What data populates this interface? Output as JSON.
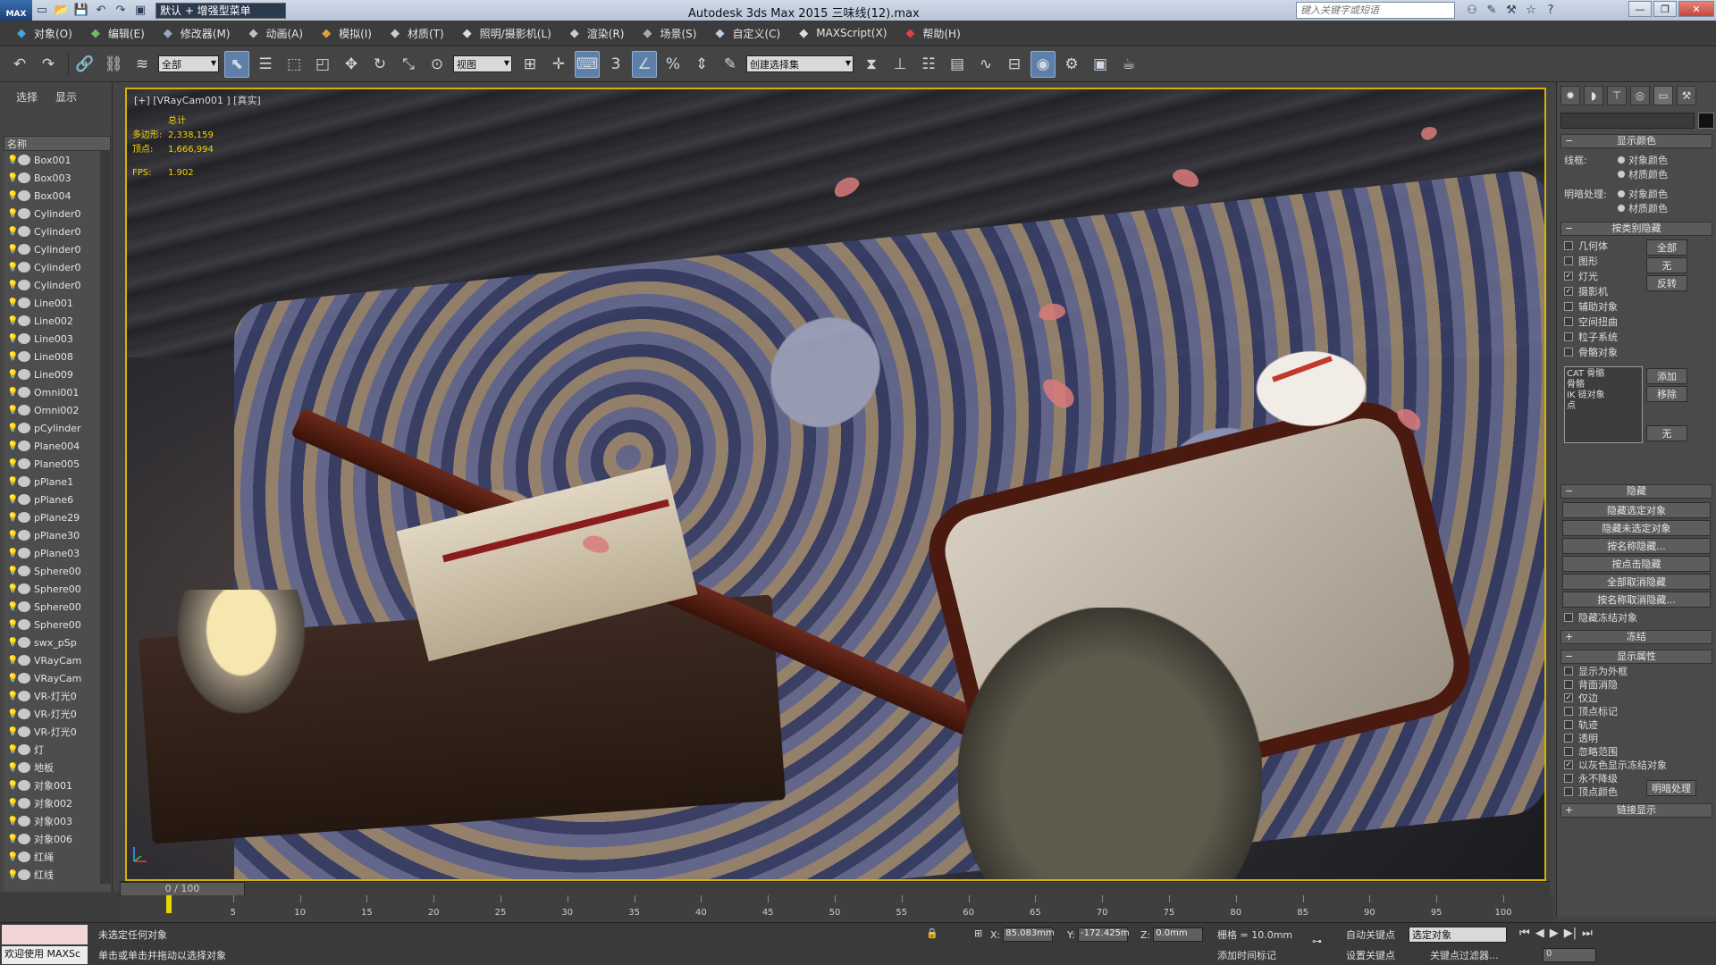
{
  "titlebar": {
    "app_logo": "MAX",
    "workspace": "默认 + 增强型菜单",
    "window_title": "Autodesk 3ds Max  2015      三味线(12).max",
    "search_placeholder": "键入关键字或短语",
    "right_icons": [
      "binoculars-icon",
      "tools-icon",
      "exchange-icon",
      "star-icon",
      "help-icon"
    ],
    "controls": [
      "—",
      "❐",
      "✕"
    ]
  },
  "menus": [
    {
      "label": "对象(O)",
      "icon": "objects-icon",
      "color": "#4aa0e0"
    },
    {
      "label": "编辑(E)",
      "icon": "edit-icon",
      "color": "#6bbf5a"
    },
    {
      "label": "修改器(M)",
      "icon": "modifier-icon",
      "color": "#9aa8c0"
    },
    {
      "label": "动画(A)",
      "icon": "animation-icon",
      "color": "#c0c0c0"
    },
    {
      "label": "模拟(I)",
      "icon": "simulation-icon",
      "color": "#e0a040"
    },
    {
      "label": "材质(T)",
      "icon": "material-icon",
      "color": "#cccccc"
    },
    {
      "label": "照明/摄影机(L)",
      "icon": "light-icon",
      "color": "#dddddd"
    },
    {
      "label": "渲染(R)",
      "icon": "render-icon",
      "color": "#cccccc"
    },
    {
      "label": "场景(S)",
      "icon": "scene-icon",
      "color": "#aaaaaa"
    },
    {
      "label": "自定义(C)",
      "icon": "customize-icon",
      "color": "#bcd0e6"
    },
    {
      "label": "MAXScript(X)",
      "icon": "script-icon",
      "color": "#dddddd"
    },
    {
      "label": "帮助(H)",
      "icon": "help-icon",
      "color": "#e04040"
    }
  ],
  "toolbar": {
    "filter": "全部",
    "ref_coord": "视图",
    "selection_set_placeholder": "创建选择集"
  },
  "explorer": {
    "tabs": [
      "选择",
      "显示"
    ],
    "column_header": "名称",
    "items": [
      "Box001",
      "Box003",
      "Box004",
      "Cylinder0",
      "Cylinder0",
      "Cylinder0",
      "Cylinder0",
      "Cylinder0",
      "Line001",
      "Line002",
      "Line003",
      "Line008",
      "Line009",
      "Omni001",
      "Omni002",
      "pCylinder",
      "Plane004",
      "Plane005",
      "pPlane1",
      "pPlane6",
      "pPlane29",
      "pPlane30",
      "pPlane03",
      "Sphere00",
      "Sphere00",
      "Sphere00",
      "Sphere00",
      "swx_pSp",
      "VRayCam",
      "VRayCam",
      "VR-灯光0",
      "VR-灯光0",
      "VR-灯光0",
      "灯",
      "地板",
      "对象001",
      "对象002",
      "对象003",
      "对象006",
      "红绳",
      "红线"
    ]
  },
  "viewport": {
    "label": "[+] [VRayCam001 ] [真实]",
    "stats_header": "总计",
    "stats": [
      {
        "key": "多边形:",
        "value": "2,338,159"
      },
      {
        "key": "顶点:",
        "value": "1,666,994"
      }
    ],
    "fps_key": "FPS:",
    "fps_value": "1.902",
    "border_color": "#d4b300"
  },
  "command_panel": {
    "tabs": [
      "create-icon",
      "modify-icon",
      "hierarchy-icon",
      "motion-icon",
      "display-icon",
      "utilities-icon"
    ],
    "display_color": {
      "title": "显示颜色",
      "wireframe_label": "线框:",
      "shaded_label": "明暗处理:",
      "option_object": "对象颜色",
      "option_material": "材质颜色"
    },
    "hide_by_category": {
      "title": "按类别隐藏",
      "categories": [
        {
          "label": "几何体",
          "checked": false
        },
        {
          "label": "图形",
          "checked": false
        },
        {
          "label": "灯光",
          "checked": true
        },
        {
          "label": "摄影机",
          "checked": true
        },
        {
          "label": "辅助对象",
          "checked": false
        },
        {
          "label": "空间扭曲",
          "checked": false
        },
        {
          "label": "粒子系统",
          "checked": false
        },
        {
          "label": "骨骼对象",
          "checked": false
        }
      ],
      "buttons": [
        "全部",
        "无",
        "反转"
      ],
      "list": [
        "CAT 骨骼",
        "骨骼",
        "IK 链对象",
        "点"
      ],
      "list_buttons": [
        "添加",
        "移除",
        "无"
      ]
    },
    "hide": {
      "title": "隐藏",
      "buttons": [
        "隐藏选定对象",
        "隐藏未选定对象",
        "按名称隐藏...",
        "按点击隐藏",
        "全部取消隐藏",
        "按名称取消隐藏..."
      ],
      "checkbox": "隐藏冻结对象"
    },
    "freeze_title": "冻结",
    "display_props": {
      "title": "显示属性",
      "items": [
        {
          "label": "显示为外框",
          "checked": false
        },
        {
          "label": "背面消隐",
          "checked": false
        },
        {
          "label": "仅边",
          "checked": true
        },
        {
          "label": "顶点标记",
          "checked": false
        },
        {
          "label": "轨迹",
          "checked": false
        },
        {
          "label": "透明",
          "checked": false
        },
        {
          "label": "忽略范围",
          "checked": false
        },
        {
          "label": "以灰色显示冻结对象",
          "checked": true
        },
        {
          "label": "永不降级",
          "checked": false
        },
        {
          "label": "顶点颜色",
          "checked": false
        }
      ],
      "shaded_button": "明暗处理"
    },
    "link_display_title": "链接显示"
  },
  "timeline": {
    "slider_label": "0 / 100",
    "ticks": [
      0,
      5,
      10,
      15,
      20,
      25,
      30,
      35,
      40,
      45,
      50,
      55,
      60,
      65,
      70,
      75,
      80,
      85,
      90,
      95,
      100
    ]
  },
  "statusbar": {
    "maxscript_label": "欢迎使用 MAXSc",
    "status_top": "未选定任何对象",
    "status_bottom": "单击或单击并拖动以选择对象",
    "x_label": "X:",
    "x_value": "85.083mm",
    "y_label": "Y:",
    "y_value": "-172.425m",
    "z_label": "Z:",
    "z_value": "0.0mm",
    "grid": "栅格 = 10.0mm",
    "add_time_tag": "添加时间标记",
    "auto_key": "自动关键点",
    "set_key": "设置关键点",
    "selection_filter": "选定对象",
    "key_filters": "关键点过滤器...",
    "frame_value": "0"
  }
}
